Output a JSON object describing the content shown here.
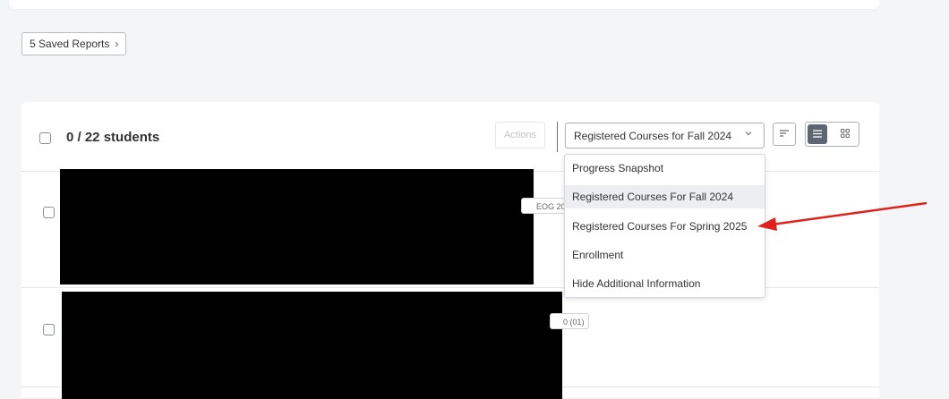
{
  "saved_reports": {
    "label": "5 Saved Reports",
    "chevron": "chevron-right-icon"
  },
  "list": {
    "count_label": "0 / 22 students",
    "actions_label": "Actions",
    "view_select": {
      "selected": "Registered Courses for Fall 2024",
      "caret": "chevron-down-icon"
    },
    "icons": {
      "sort": "sort-icon",
      "list_view": "list-view-icon",
      "grid_view": "grid-view-icon"
    }
  },
  "dropdown": {
    "options": [
      "Progress Snapshot",
      "Registered Courses For Fall 2024",
      "Registered Courses For Spring 2025",
      "Enrollment",
      "Hide Additional Information"
    ],
    "highlighted_index": 1
  },
  "rows": [
    {
      "tag": "EOG 20"
    },
    {
      "tag": "0 (01)"
    }
  ],
  "annotation": {
    "color": "#e0201b"
  },
  "colors": {
    "active_view": "#5d6672",
    "highlight": "#eceef1"
  }
}
